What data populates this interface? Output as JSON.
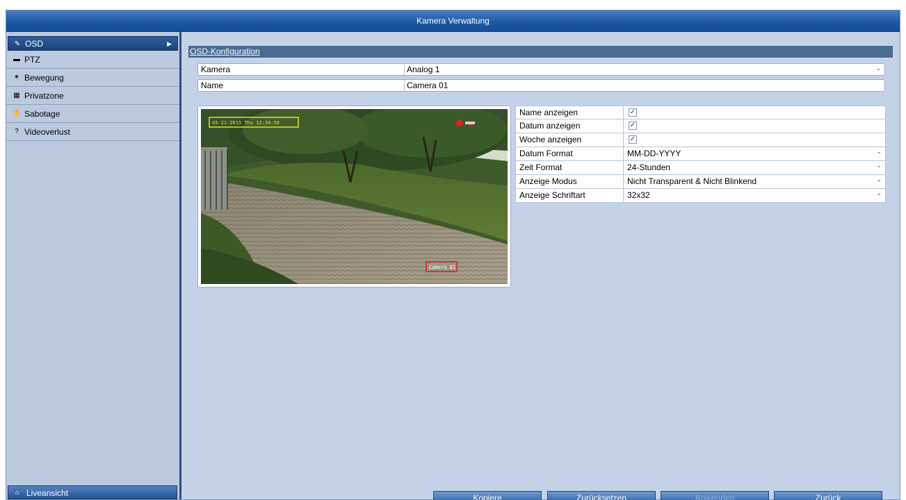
{
  "window": {
    "title": "Kamera Verwaltung"
  },
  "sidebar": {
    "items": [
      {
        "label": "OSD",
        "icon": "pencil-icon",
        "active": true
      },
      {
        "label": "PTZ",
        "icon": "ptz-camera-icon"
      },
      {
        "label": "Bewegung",
        "icon": "running-person-icon"
      },
      {
        "label": "Privatzone",
        "icon": "privacy-mask-icon"
      },
      {
        "label": "Sabotage",
        "icon": "hand-icon"
      },
      {
        "label": "Videoverlust",
        "icon": "question-box-icon"
      }
    ],
    "live_view": "Liveansicht"
  },
  "main": {
    "section_title": "OSD-Konfiguration",
    "camera": {
      "label": "Kamera",
      "value": "Analog 1"
    },
    "name": {
      "label": "Name",
      "value": "Camera 01"
    },
    "preview": {
      "date_overlay_text": "05-21-2015 Thu 12:34:56",
      "name_overlay_text": "Camera 01",
      "overlay_colors": {
        "date_box": "#e8e020",
        "name_box": "#e02020"
      }
    },
    "options": [
      {
        "label": "Name anzeigen",
        "type": "checkbox",
        "checked": true
      },
      {
        "label": "Datum anzeigen",
        "type": "checkbox",
        "checked": true
      },
      {
        "label": "Woche anzeigen",
        "type": "checkbox",
        "checked": true
      },
      {
        "label": "Datum Format",
        "type": "select",
        "value": "MM-DD-YYYY"
      },
      {
        "label": "Zeit Format",
        "type": "select",
        "value": "24-Stunden"
      },
      {
        "label": "Anzeige Modus",
        "type": "select",
        "value": "Nicht Transparent & Nicht Blinkend"
      },
      {
        "label": "Anzeige Schriftart",
        "type": "select",
        "value": "32x32"
      }
    ],
    "check_mark": "✓"
  },
  "buttons": {
    "copy": "Kopiere",
    "reset": "Zurücksetzen",
    "apply": "Anwenden",
    "back": "Zurück"
  },
  "colors": {
    "titlebar": "#1b58a6",
    "panel": "#c4d2e8",
    "section_header": "#4a6b94"
  }
}
